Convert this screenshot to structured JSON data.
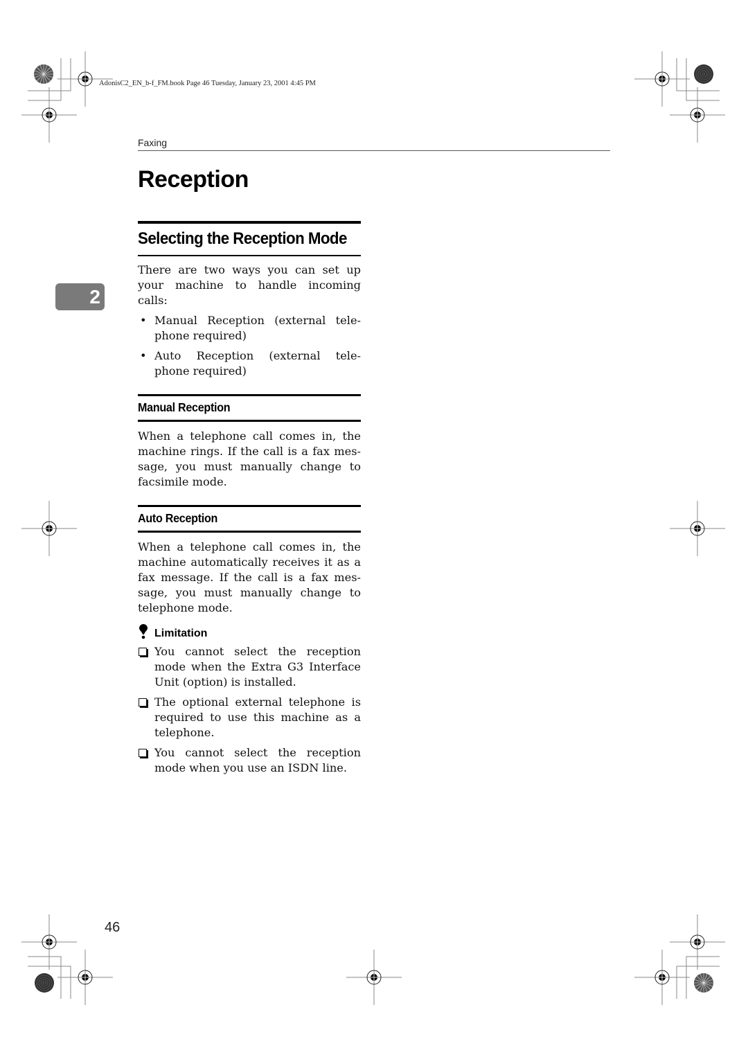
{
  "header_meta": "AdonisC2_EN_b-f_FM.book  Page 46  Tuesday, January 23, 2001  4:45 PM",
  "running_head": "Faxing",
  "chapter_tab": "2",
  "page_title": "Reception",
  "section": {
    "title": "Selecting the Reception Mode",
    "intro_lines": [
      "There are two ways you can set up",
      "your machine to handle incoming",
      "calls:"
    ],
    "bullets": [
      {
        "lines": [
          "Manual Reception (external tele-",
          "phone required)"
        ]
      },
      {
        "lines": [
          "Auto Reception (external tele-",
          "phone required)"
        ]
      }
    ]
  },
  "manual_reception": {
    "title": "Manual Reception",
    "lines": [
      "When a telephone call comes in, the",
      "machine rings. If the call is a fax mes-",
      "sage, you must manually change to",
      "facsimile mode."
    ]
  },
  "auto_reception": {
    "title": "Auto Reception",
    "lines": [
      "When a telephone call comes in, the",
      "machine automatically receives it as a",
      "fax message. If the call is a fax mes-",
      "sage, you must manually change to",
      "telephone mode."
    ]
  },
  "limitation": {
    "label": "Limitation",
    "icon": "exclamation-icon",
    "items": [
      {
        "lines": [
          "You cannot select the reception",
          "mode when the Extra G3 Interface",
          "Unit (option) is installed."
        ]
      },
      {
        "lines": [
          "The optional external telephone is",
          "required to use this machine as a",
          "telephone."
        ]
      },
      {
        "lines": [
          "You cannot select the reception",
          "mode when you use an ISDN line."
        ]
      }
    ]
  },
  "page_number": "46"
}
